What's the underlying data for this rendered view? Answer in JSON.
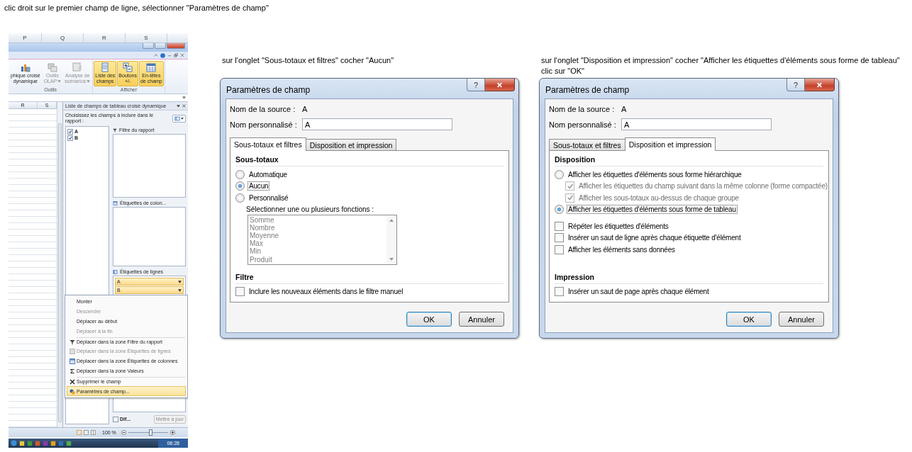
{
  "instruction": "clic droit sur le premier champ de ligne, sélectionner \"Paramètres de champ\"",
  "excel": {
    "column_headers": [
      "P",
      "Q",
      "R",
      "S"
    ],
    "ribbon_groups": [
      {
        "label": "Outils",
        "buttons": [
          {
            "lines": [
              "phique croisé",
              "dynamique"
            ],
            "disabled": false,
            "selected": false,
            "dropdown": false
          },
          {
            "lines": [
              "Outils",
              "OLAP"
            ],
            "disabled": true,
            "selected": false,
            "dropdown": true
          },
          {
            "lines": [
              "Analyse de",
              "scénarios"
            ],
            "disabled": true,
            "selected": false,
            "dropdown": true
          }
        ]
      },
      {
        "label": "Afficher",
        "buttons": [
          {
            "lines": [
              "Liste des",
              "champs"
            ],
            "disabled": false,
            "selected": true,
            "dropdown": false
          },
          {
            "lines": [
              "Boutons",
              "+/-"
            ],
            "disabled": false,
            "selected": true,
            "dropdown": false
          },
          {
            "lines": [
              "En-têtes",
              "de champ"
            ],
            "disabled": false,
            "selected": true,
            "dropdown": false
          }
        ]
      }
    ],
    "sheet_headers": [
      "R",
      "S"
    ],
    "pane": {
      "title": "Liste de champs de tableau croisé dynamique",
      "prompt": "Choisissez les champs à inclure dans le rapport :",
      "fields": [
        {
          "label": "A",
          "checked": true
        },
        {
          "label": "B",
          "checked": true
        }
      ],
      "areas": [
        {
          "kind": "filter",
          "label": "Filtre du rapport"
        },
        {
          "kind": "columns",
          "label": "Étiquettes de colon..."
        },
        {
          "kind": "rows",
          "label": "Étiquettes de lignes",
          "items": [
            "A",
            "B"
          ]
        }
      ],
      "defer": {
        "label": "Dif...",
        "checked": false
      },
      "update_button": {
        "label": "Mettre à jour",
        "disabled": true
      }
    },
    "context_menu": [
      {
        "label": "Monter",
        "kind": "plain",
        "disabled": false,
        "selected": false,
        "separator_before": false
      },
      {
        "label": "Descendre",
        "kind": "plain",
        "disabled": true,
        "selected": false,
        "separator_before": false
      },
      {
        "label": "Déplacer au début",
        "kind": "plain",
        "disabled": false,
        "selected": false,
        "separator_before": false
      },
      {
        "label": "Déplacer à la fin",
        "kind": "plain",
        "disabled": true,
        "selected": false,
        "separator_before": false
      },
      {
        "label": "Déplacer dans la zone Filtre du rapport",
        "kind": "filter",
        "disabled": false,
        "selected": false,
        "separator_before": true
      },
      {
        "label": "Déplacer dans la zone Étiquettes de lignes",
        "kind": "rows",
        "disabled": true,
        "selected": false,
        "separator_before": false
      },
      {
        "label": "Déplacer dans la zone Étiquettes de colonnes",
        "kind": "columns",
        "disabled": false,
        "selected": false,
        "separator_before": false
      },
      {
        "label": "Déplacer dans la zone Valeurs",
        "kind": "values",
        "disabled": false,
        "selected": false,
        "separator_before": false
      },
      {
        "label": "Supprimer le champ",
        "kind": "delete",
        "disabled": false,
        "selected": false,
        "separator_before": true
      },
      {
        "label": "Paramètres de champ...",
        "kind": "settings",
        "disabled": false,
        "selected": true,
        "separator_before": true
      }
    ],
    "status_bar": {
      "zoom": "100 %",
      "level": 0.55
    },
    "taskbar": {
      "time": "08:28"
    }
  },
  "dialogs": [
    {
      "caption": [
        "sur l'onglet \"Sous-totaux et filtres\" cocher \"Aucun\""
      ],
      "title": "Paramètres de champ",
      "help": "?",
      "source_label": "Nom de la source :",
      "source_value": "A",
      "custom_label": "Nom personnalisé :",
      "custom_value": "A",
      "tabs": [
        {
          "label": "Sous-totaux et filtres",
          "selected": true
        },
        {
          "label": "Disposition et impression",
          "selected": false
        }
      ],
      "sections": [
        {
          "heading": "Sous-totaux",
          "items": [
            {
              "kind": "radio",
              "label": "Automatique",
              "selected": false,
              "focused": false
            },
            {
              "kind": "radio",
              "label": "Aucun",
              "selected": true,
              "focused": true
            },
            {
              "kind": "radio",
              "label": "Personnalisé",
              "selected": false,
              "focused": false,
              "children": [
                {
                  "kind": "label",
                  "label": "Sélectionner une ou plusieurs fonctions :"
                },
                {
                  "kind": "listbox",
                  "options": [
                    "Somme",
                    "Nombre",
                    "Moyenne",
                    "Max",
                    "Min",
                    "Produit"
                  ],
                  "disabled": true
                }
              ]
            }
          ]
        },
        {
          "heading": "Filtre",
          "items": [
            {
              "kind": "checkbox",
              "label": "Inclure les nouveaux éléments dans le filtre manuel",
              "checked": false,
              "disabled": false,
              "focused": false
            }
          ]
        }
      ],
      "buttons": [
        {
          "label": "OK",
          "default": true
        },
        {
          "label": "Annuler",
          "default": false
        }
      ]
    },
    {
      "caption": [
        "sur l'onglet \"Disposition et impression\" cocher \"Afficher les étiquettes d'éléments sous forme de tableau\"",
        "clic sur \"OK\""
      ],
      "title": "Paramètres de champ",
      "help": "?",
      "source_label": "Nom de la source :",
      "source_value": "A",
      "custom_label": "Nom personnalisé :",
      "custom_value": "A",
      "tabs": [
        {
          "label": "Sous-totaux et filtres",
          "selected": false
        },
        {
          "label": "Disposition et impression",
          "selected": true
        }
      ],
      "sections": [
        {
          "heading": "Disposition",
          "items": [
            {
              "kind": "radio",
              "label": "Afficher les étiquettes d'éléments sous forme hiérarchique",
              "selected": false,
              "focused": false,
              "children": [
                {
                  "kind": "checkbox",
                  "label": "Afficher les étiquettes du champ suivant dans la même colonne (forme compactée)",
                  "checked": true,
                  "disabled": true,
                  "focused": false
                },
                {
                  "kind": "checkbox",
                  "label": "Afficher les sous-totaux au-dessus de chaque groupe",
                  "checked": true,
                  "disabled": true,
                  "focused": false
                }
              ]
            },
            {
              "kind": "radio",
              "label": "Afficher les étiquettes d'éléments sous forme de tableau",
              "selected": true,
              "focused": true
            },
            {
              "kind": "checkbox",
              "label": "Répéter les étiquettes d'éléments",
              "checked": false,
              "disabled": false,
              "focused": false
            },
            {
              "kind": "checkbox",
              "label": "Insérer un saut de ligne après chaque étiquette d'élément",
              "checked": false,
              "disabled": false,
              "focused": false
            },
            {
              "kind": "checkbox",
              "label": "Afficher les éléments sans données",
              "checked": false,
              "disabled": false,
              "focused": false
            }
          ]
        },
        {
          "heading": "Impression",
          "items": [
            {
              "kind": "checkbox",
              "label": "Insérer un saut de page après chaque élément",
              "checked": false,
              "disabled": false,
              "focused": false
            }
          ]
        }
      ],
      "buttons": [
        {
          "label": "OK",
          "default": true
        },
        {
          "label": "Annuler",
          "default": false
        }
      ]
    }
  ]
}
